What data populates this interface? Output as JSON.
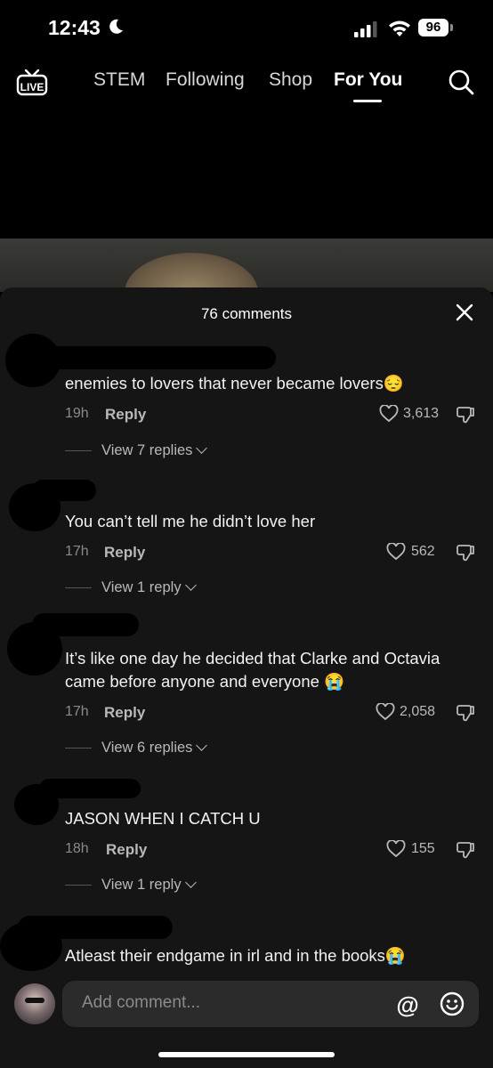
{
  "status_bar": {
    "time": "12:43",
    "battery": "96"
  },
  "nav": {
    "tabs": [
      {
        "label": "STEM"
      },
      {
        "label": "Following"
      },
      {
        "label": "Shop"
      },
      {
        "label": "For You"
      }
    ],
    "active_tab": "For You"
  },
  "comments_sheet": {
    "title": "76 comments",
    "comments": [
      {
        "text": "enemies to lovers that never became lovers😔",
        "time": "19h",
        "reply_label": "Reply",
        "likes": "3,613",
        "view_replies": "View 7 replies"
      },
      {
        "text": "You can’t tell me he didn’t love her",
        "time": "17h",
        "reply_label": "Reply",
        "likes": "562",
        "view_replies": "View 1 reply"
      },
      {
        "text": "It’s like one day he decided that Clarke and Octavia came before anyone and everyone 😭",
        "time": "17h",
        "reply_label": "Reply",
        "likes": "2,058",
        "view_replies": "View 6 replies"
      },
      {
        "text": "JASON WHEN I CATCH U",
        "time": "18h",
        "reply_label": "Reply",
        "likes": "155",
        "view_replies": "View 1 reply"
      },
      {
        "text": "Atleast their endgame in irl and in the books😭"
      }
    ]
  },
  "composer": {
    "placeholder": "Add comment..."
  }
}
